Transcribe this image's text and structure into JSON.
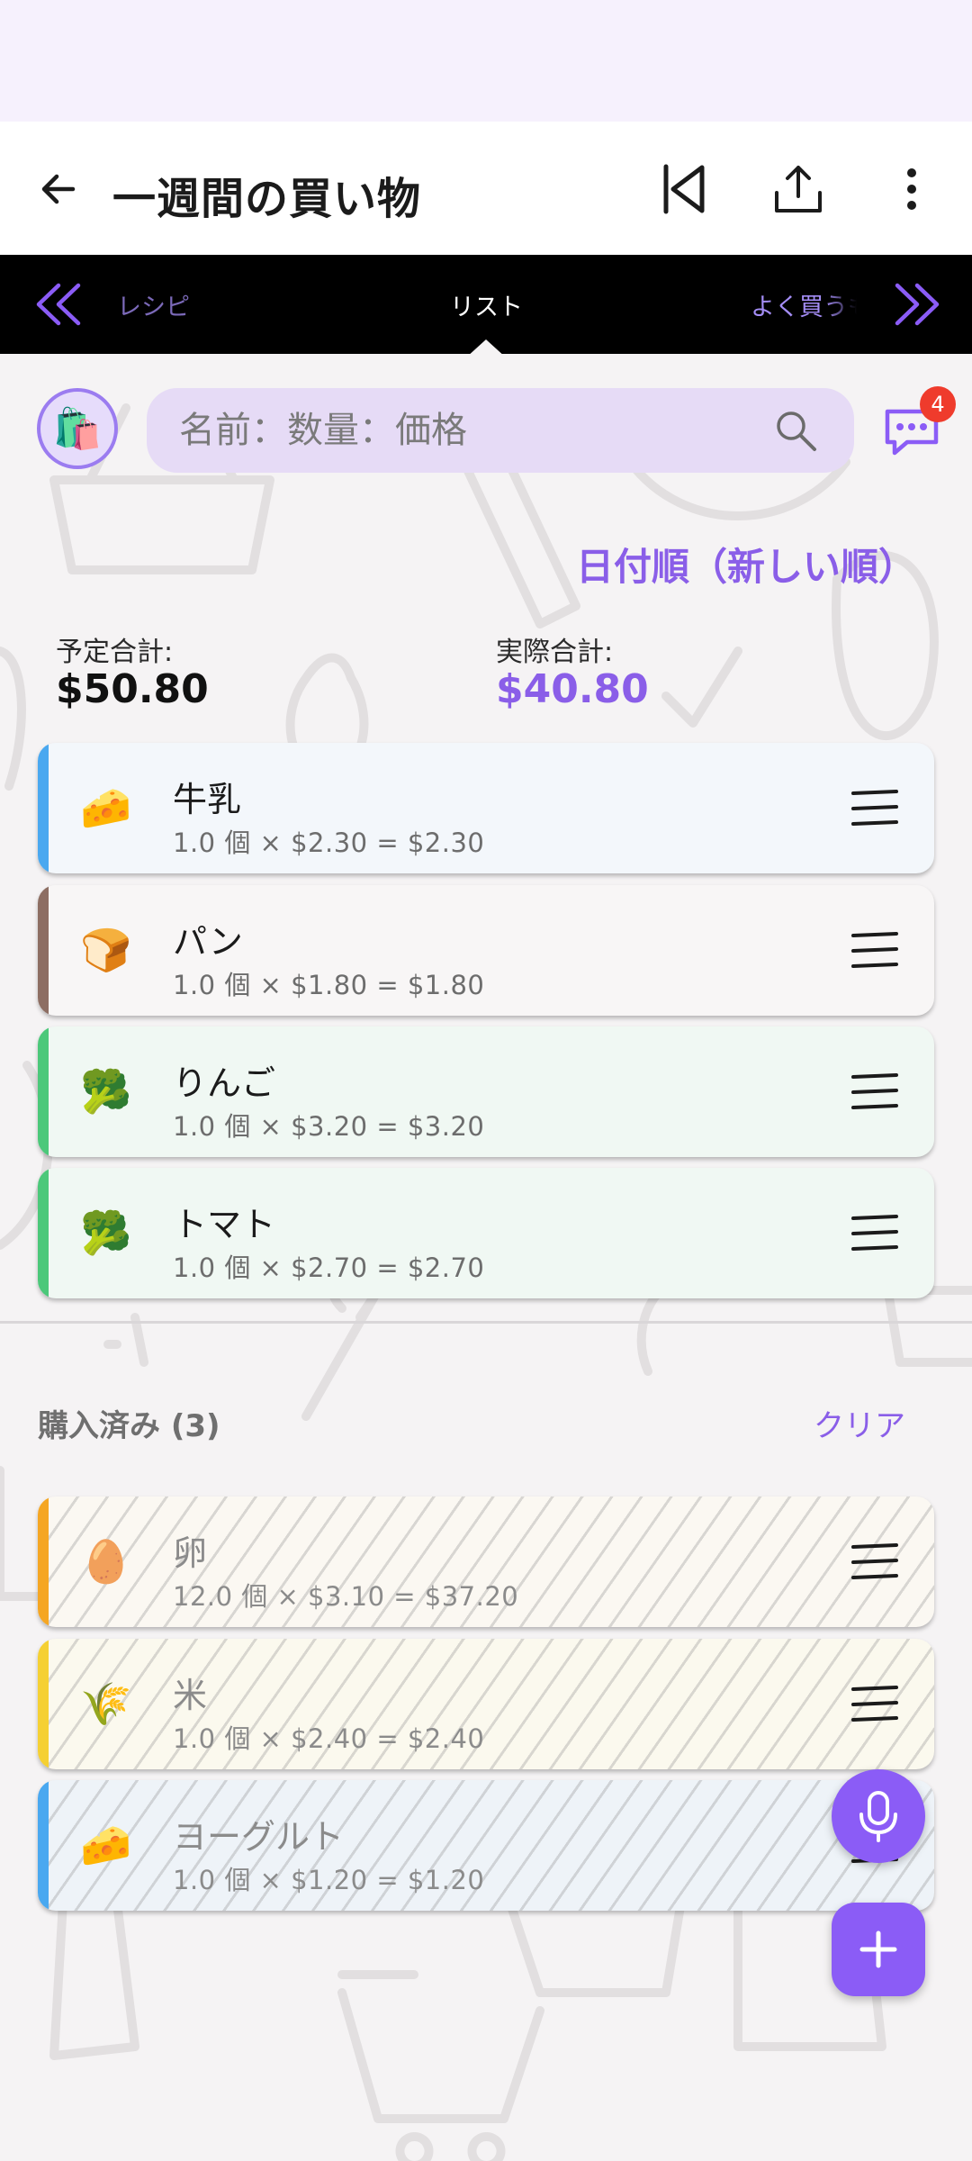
{
  "app_bar": {
    "title": "一週間の買い物"
  },
  "tabs": {
    "left": "レシピ",
    "center": "リスト",
    "right": "よく買うもの"
  },
  "search": {
    "placeholder": "名前：数量：価格",
    "badge_count": "4"
  },
  "sort_label": "日付順（新しい順）",
  "totals": {
    "planned_label": "予定合計:",
    "planned_value": "$50.80",
    "actual_label": "実際合計:",
    "actual_value": "$40.80"
  },
  "items": [
    {
      "icon": "cheese-icon",
      "emoji": "🧀",
      "name": "牛乳",
      "detail": "1.0 個 × $2.30 = $2.30",
      "stripe": "#4aa8f0",
      "bg": "#f3f7fb"
    },
    {
      "icon": "bread-icon",
      "emoji": "🍞",
      "name": "パン",
      "detail": "1.0 個 × $1.80 = $1.80",
      "stripe": "#8d6e63",
      "bg": "#f8f6f6"
    },
    {
      "icon": "broccoli-icon",
      "emoji": "🥦",
      "name": "りんご",
      "detail": "1.0 個 × $3.20 = $3.20",
      "stripe": "#4cc87a",
      "bg": "#f0f8f3"
    },
    {
      "icon": "broccoli-icon",
      "emoji": "🥦",
      "name": "トマト",
      "detail": "1.0 個 × $2.70 = $2.70",
      "stripe": "#4cc87a",
      "bg": "#f0f8f3"
    }
  ],
  "purchased": {
    "header": "購入済み (3)",
    "clear_label": "クリア",
    "items": [
      {
        "icon": "egg-icon",
        "emoji": "🥚",
        "name": "卵",
        "detail": "12.0 個 × $3.10 = $37.20",
        "stripe": "#f5a623",
        "bg": "#fbf8f2"
      },
      {
        "icon": "rice-icon",
        "emoji": "🌾",
        "name": "米",
        "detail": "1.0 個 × $2.40 = $2.40",
        "stripe": "#f5d033",
        "bg": "#fbf9ee"
      },
      {
        "icon": "cheese-icon",
        "emoji": "🧀",
        "name": "ヨーグルト",
        "detail": "1.0 個 × $1.20 = $1.20",
        "stripe": "#4aa8f0",
        "bg": "#eef3f8"
      }
    ]
  },
  "colors": {
    "accent": "#8b5cf6",
    "tab_bg": "#000000",
    "search_bg": "#e6dbf6"
  }
}
